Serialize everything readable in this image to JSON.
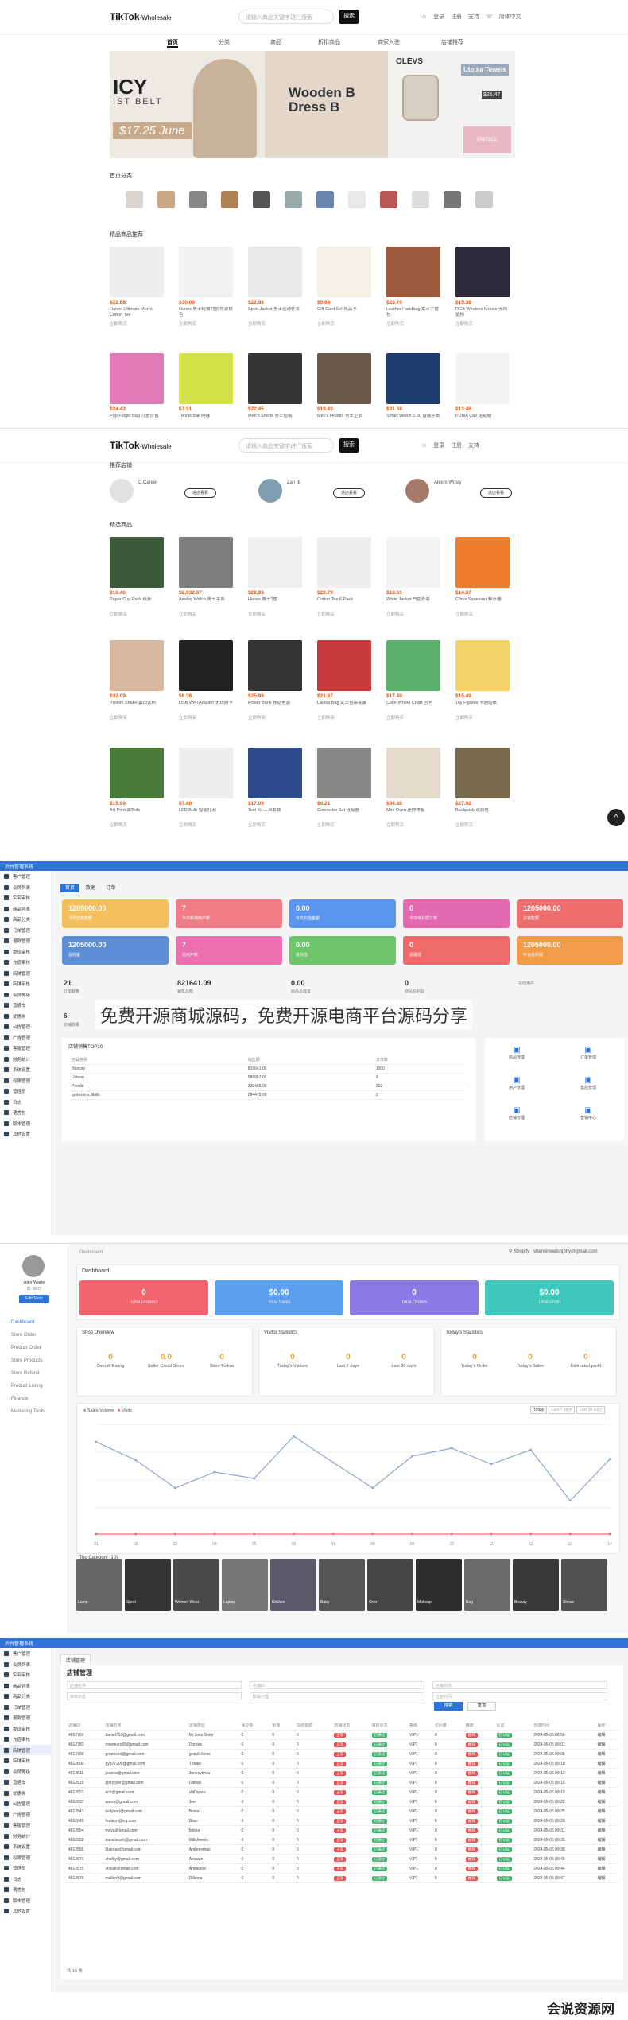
{
  "store": {
    "logo": "TikTok",
    "logo_sub": "-Wholesale",
    "search_placeholder": "请输入商品关键字进行搜索",
    "search_btn": "搜索",
    "header_links": [
      "登录",
      "注册",
      "支持",
      "简体中文"
    ],
    "nav": [
      "首页",
      "分类",
      "商品",
      "折扣商品",
      "商家入驻",
      "店铺推荐"
    ],
    "banner": {
      "left_big": "ICY",
      "left_sub": "IST BELT",
      "left_price": "$17.25 June",
      "mid_title": "Wooden B",
      "mid_title2": "Dress B",
      "right_brand": "OLEVS",
      "right_tag": "Utopia Towels",
      "right_price": "$26.47",
      "right_label": "ONITLEE"
    },
    "sections": {
      "categories": "首页分类",
      "hot": "精品商品推荐",
      "shops": "推荐店铺",
      "selected": "精选商品"
    },
    "products_row1": [
      {
        "price": "$22.68",
        "name": "Hanes Ultimate Men's Cotton Tee"
      },
      {
        "price": "$30.09",
        "name": "Hanes 男士短袖T恤6件装白色"
      },
      {
        "price": "$22.98",
        "name": "Sport Jacket 男士运动外套"
      },
      {
        "price": "$9.89",
        "name": "Gift Card Set 礼品卡"
      },
      {
        "price": "$23.79",
        "name": "Leather Handbag 女士手提包"
      },
      {
        "price": "$15.38",
        "name": "RGB Wireless Mouse 无线鼠标"
      }
    ],
    "products_row2": [
      {
        "price": "$24.43",
        "name": "Pop Fidget Bag 儿童背包"
      },
      {
        "price": "$7.91",
        "name": "Tennis Ball 网球"
      },
      {
        "price": "$22.45",
        "name": "Men's Shorts 男士短裤"
      },
      {
        "price": "$19.43",
        "name": "Men's Hoodie 男士卫衣"
      },
      {
        "price": "$31.68",
        "name": "Smart Watch 6:30 智能手表"
      },
      {
        "price": "$13.46",
        "name": "PUMA Cap 运动帽"
      }
    ],
    "shops": [
      {
        "name": "C.Career",
        "btn": "进店看看"
      },
      {
        "name": "Zan di",
        "btn": "进店看看"
      },
      {
        "name": "Alexm Wosly",
        "btn": "进店看看"
      }
    ],
    "selected_row1": [
      {
        "price": "$16.46",
        "name": "Paper Cup Pack 纸杯"
      },
      {
        "price": "$2,932.37",
        "name": "Analog Watch 男士手表"
      },
      {
        "price": "$22.98",
        "name": "Hanes 男士T恤"
      },
      {
        "price": "$28.79",
        "name": "Cotton Tee 6-Pack"
      },
      {
        "price": "$18.61",
        "name": "White Jacket 白色外套"
      },
      {
        "price": "$14.37",
        "name": "Citrus Squeezer 榨汁器"
      }
    ],
    "selected_row2": [
      {
        "price": "$32.09",
        "name": "Protein Shake 蛋白饮料"
      },
      {
        "price": "$6.36",
        "name": "USB WiFi Adapter 无线网卡"
      },
      {
        "price": "$25.99",
        "name": "Power Bank 移动电源"
      },
      {
        "price": "$21.67",
        "name": "Ladies Bag 女士包袋套装"
      },
      {
        "price": "$17.49",
        "name": "Color Wheel Chart 色卡"
      },
      {
        "price": "$15.49",
        "name": "Toy Figures 卡通贴纸"
      }
    ],
    "selected_row3": [
      {
        "price": "$15.99",
        "name": "Art Print 装饰画"
      },
      {
        "price": "$7.60",
        "name": "LED Bulb 智能灯泡"
      },
      {
        "price": "$17.09",
        "name": "Tool Kit 工具套装"
      },
      {
        "price": "$9.21",
        "name": "Connector Set 连接器"
      },
      {
        "price": "$34.88",
        "name": "Mini Oven 迷你烤箱"
      },
      {
        "price": "$27.92",
        "name": "Backpack 双肩包"
      }
    ],
    "card_footer": "立即购买",
    "back_top": "^"
  },
  "admin": {
    "topbar": "后台管理系统",
    "tabs": [
      "首页",
      "数据",
      "订单"
    ],
    "sidebar": [
      "客户管理",
      "会员列表",
      "实名审核",
      "商品列表",
      "商品分类",
      "订单管理",
      "退款管理",
      "提现审核",
      "充值审核",
      "店铺管理",
      "店铺审核",
      "会员等级",
      "直通车",
      "优惠券",
      "公告管理",
      "广告管理",
      "客服管理",
      "财务统计",
      "系统设置",
      "权限管理",
      "管理员",
      "日志",
      "语言包",
      "版本管理",
      "其他设置"
    ],
    "stats_row1": [
      {
        "v": "1205000.00",
        "l": "今日总销售额",
        "c": "#f3c05d"
      },
      {
        "v": "7",
        "l": "今日新增用户数",
        "c": "#f07d86"
      },
      {
        "v": "0.00",
        "l": "今日充值金额",
        "c": "#5a95ef"
      },
      {
        "v": "0",
        "l": "今日待处理订单",
        "c": "#e569b0"
      },
      {
        "v": "1205000.00",
        "l": "总销售额",
        "c": "#f06d6d"
      }
    ],
    "stats_row2": [
      {
        "v": "1205000.00",
        "l": "总收益",
        "c": "#5d8fd6"
      },
      {
        "v": "7",
        "l": "总用户数",
        "c": "#ec6fb0"
      },
      {
        "v": "0.00",
        "l": "总充值",
        "c": "#6fc66a"
      },
      {
        "v": "0",
        "l": "总提现",
        "c": "#ef6b6b"
      },
      {
        "v": "1205000.00",
        "l": "平台总利润",
        "c": "#f29c4a"
      }
    ],
    "plain_stats": [
      {
        "v": "21",
        "l": "订单数量"
      },
      {
        "v": "821641.09",
        "l": "销售总额"
      },
      {
        "v": "0.00",
        "l": "商品总成本"
      },
      {
        "v": "0",
        "l": "商品总利润"
      },
      {
        "v": "",
        "l": "在线用户"
      }
    ],
    "extra_stat": {
      "v": "6",
      "l": "店铺数量"
    },
    "top_title": "店铺销售TOP10",
    "top_headers": [
      "店铺名称",
      "销售额",
      "订单数"
    ],
    "top_rows": [
      [
        "Hancey",
        "821641.09",
        "1200"
      ],
      [
        "Ustoon",
        "586967.09",
        "9"
      ],
      [
        "Poodle",
        "320465.09",
        "302"
      ],
      [
        "godeskins.Skills",
        "284479.09",
        "3"
      ]
    ],
    "quick": [
      "商品管理",
      "订单管理",
      "用户管理",
      "售后管理",
      "店铺管理",
      "营销中心"
    ]
  },
  "watermark": "免费开源商城源码，免费开源电商平台源码分享",
  "seller": {
    "breadcrumb": "Dashboard",
    "user": "Shopify",
    "email": "sherwinwelshjphy@gmail.com",
    "side_name": "Alex Wane",
    "side_id": "ID: 8872",
    "side_btn": "Edit Shop",
    "menu": [
      "Dashboard",
      "Store Order",
      "Product Order",
      "Store Products",
      "Store Refund",
      "Product Listing",
      "Finance",
      "Marketing Tools"
    ],
    "title": "Dashboard",
    "cards": [
      {
        "v": "0",
        "l": "Total Product",
        "c": "#f2656f"
      },
      {
        "v": "$0.00",
        "l": "Total Sales",
        "c": "#5d9eef"
      },
      {
        "v": "0",
        "l": "Total Orders",
        "c": "#8c7ae6"
      },
      {
        "v": "$0.00",
        "l": "Total Profit",
        "c": "#3ec8bd"
      }
    ],
    "shop_overview": {
      "title": "Shop Overview",
      "items": [
        {
          "v": "0",
          "l": "Overall Rating"
        },
        {
          "v": "0.0",
          "l": "Seller Credit Score"
        },
        {
          "v": "0",
          "l": "Store Follow"
        }
      ]
    },
    "visitor": {
      "title": "Visitor Statistics",
      "items": [
        {
          "v": "0",
          "l": "Today's Visitors"
        },
        {
          "v": "0",
          "l": "Last 7 days"
        },
        {
          "v": "0",
          "l": "Last 30 days"
        }
      ]
    },
    "todays": {
      "title": "Today's Statistics",
      "items": [
        {
          "v": "0",
          "l": "Today's Order"
        },
        {
          "v": "0",
          "l": "Today's Sales"
        },
        {
          "v": "0",
          "l": "Estimated profit"
        }
      ]
    },
    "chart_legend": [
      "Sales Volume",
      "Visits"
    ],
    "chart_buttons": [
      "Today",
      "Last 7 days",
      "Last 30 days"
    ],
    "top_category_title": "Top Category (10)",
    "top_categories": [
      "Lamp",
      "Sport",
      "Women Wear",
      "Laptop",
      "Kitchen",
      "Baby",
      "Oven",
      "Makeup",
      "Bag",
      "Beauty",
      "Shoes"
    ]
  },
  "chart_data": {
    "type": "line",
    "x": [
      "01",
      "02",
      "03",
      "04",
      "05",
      "06",
      "07",
      "08",
      "09",
      "10",
      "11",
      "12",
      "13",
      "14"
    ],
    "series": [
      {
        "name": "Sales Volume",
        "values": [
          118,
          95,
          60,
          80,
          72,
          125,
          92,
          60,
          100,
          110,
          90,
          108,
          44,
          96
        ],
        "color": "#8fa5cf"
      },
      {
        "name": "Visits",
        "values": [
          2,
          2,
          2,
          2,
          2,
          2,
          2,
          2,
          2,
          2,
          2,
          2,
          2,
          2
        ],
        "color": "#e57373"
      }
    ],
    "ylim": [
      0,
      140
    ],
    "grid": true,
    "legend": "top-left"
  },
  "orders": {
    "title": "店铺管理",
    "filters": [
      "店铺名称",
      "店铺ID",
      "店铺状态",
      "审核状态",
      "所属代理",
      "注册时间"
    ],
    "search_btn": "搜索",
    "reset_btn": "重置",
    "headers": [
      "店铺ID",
      "店铺名称",
      "店铺类型",
      "保证金",
      "余额",
      "冻结金额",
      "店铺状态",
      "审核状态",
      "等级",
      "访问量",
      "推荐",
      "认证",
      "创建时间",
      "操作"
    ],
    "rows": [
      [
        "4612769",
        "daniel713@gmail.com",
        "Mr.Jonz Store",
        "0",
        "0",
        "0",
        "正常",
        "已通过",
        "VIP1",
        "0",
        "推荐",
        "已认证",
        "2024-05-05 08:56",
        "编辑"
      ],
      [
        "4612783",
        "rosemary89@gmail.com",
        "Doroka",
        "0",
        "0",
        "0",
        "正常",
        "已通过",
        "VIP1",
        "0",
        "推荐",
        "已认证",
        "2024-05-05 09:01",
        "编辑"
      ],
      [
        "4612790",
        "grantcord@gmail.com",
        "grand-Xenix",
        "0",
        "0",
        "0",
        "正常",
        "已通过",
        "VIP1",
        "0",
        "推荐",
        "已认证",
        "2024-05-05 09:05",
        "编辑"
      ],
      [
        "4612800",
        "gyg77209@gmail.com",
        "Thoaw",
        "0",
        "0",
        "0",
        "正常",
        "已通过",
        "VIP1",
        "0",
        "推荐",
        "已认证",
        "2024-05-05 09:10",
        "编辑"
      ],
      [
        "4612811",
        "jessica@gmail.com",
        "Jonesybrew",
        "0",
        "0",
        "0",
        "正常",
        "已通过",
        "VIP1",
        "0",
        "推荐",
        "已认证",
        "2024-05-05 09:12",
        "编辑"
      ],
      [
        "4612815",
        "glorytyler@gmail.com",
        "Olimax",
        "0",
        "0",
        "0",
        "正常",
        "已通过",
        "VIP1",
        "0",
        "推荐",
        "已认证",
        "2024-05-05 09:15",
        "编辑"
      ],
      [
        "4612822",
        "rich@gmail.com",
        "chiDuyen",
        "0",
        "0",
        "0",
        "正常",
        "已通过",
        "VIP1",
        "0",
        "推荐",
        "已认证",
        "2024-05-05 09:19",
        "编辑"
      ],
      [
        "4612837",
        "aaron@gmail.com",
        "Jeer",
        "0",
        "0",
        "0",
        "正常",
        "已通过",
        "VIP1",
        "0",
        "推荐",
        "已认证",
        "2024-05-05 09:22",
        "编辑"
      ],
      [
        "4612843",
        "kellyhart@gmail.com",
        "Boxon",
        "0",
        "0",
        "0",
        "正常",
        "已通过",
        "VIP1",
        "0",
        "推荐",
        "已认证",
        "2024-05-05 09:25",
        "编辑"
      ],
      [
        "4612849",
        "hudson@icq.com",
        "Blaci",
        "0",
        "0",
        "0",
        "正常",
        "已通过",
        "VIP1",
        "0",
        "推荐",
        "已认证",
        "2024-05-05 09:28",
        "编辑"
      ],
      [
        "4612854",
        "maya@gmail.com",
        "bolina",
        "0",
        "0",
        "0",
        "正常",
        "已通过",
        "VIP1",
        "0",
        "推荐",
        "已认证",
        "2024-05-05 09:31",
        "编辑"
      ],
      [
        "4612858",
        "danielmark@gmail.com",
        "MilkJewels",
        "0",
        "0",
        "0",
        "正常",
        "已通过",
        "VIP1",
        "0",
        "推荐",
        "已认证",
        "2024-05-05 09:35",
        "编辑"
      ],
      [
        "4612866",
        "blaireus@gmail.com",
        "Ambrevmao",
        "0",
        "0",
        "0",
        "正常",
        "已通过",
        "VIP1",
        "0",
        "推荐",
        "已认证",
        "2024-05-05 09:38",
        "编辑"
      ],
      [
        "4612871",
        "shelby@gmail.com",
        "Ainawie",
        "0",
        "0",
        "0",
        "正常",
        "已通过",
        "VIP1",
        "0",
        "推荐",
        "已认证",
        "2024-05-05 09:40",
        "编辑"
      ],
      [
        "4612875",
        "vhlvalt@gmail.com",
        "Amnestor",
        "0",
        "0",
        "0",
        "正常",
        "已通过",
        "VIP1",
        "0",
        "推荐",
        "已认证",
        "2024-05-05 09:44",
        "编辑"
      ],
      [
        "4612879",
        "mallon9@gmail.com",
        "Dilkona",
        "0",
        "0",
        "0",
        "正常",
        "已通过",
        "VIP1",
        "0",
        "推荐",
        "已认证",
        "2024-05-05 09:47",
        "编辑"
      ]
    ],
    "pagination": "共 16 条"
  },
  "footer_watermark": "会说资源网"
}
